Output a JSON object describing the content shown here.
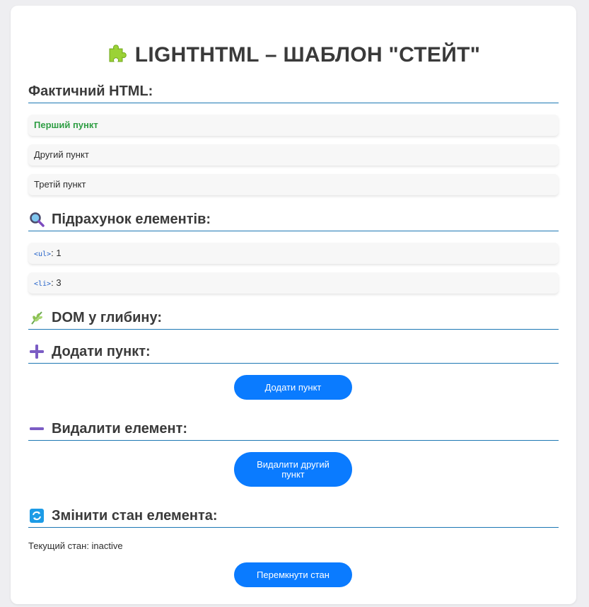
{
  "page": {
    "title_emoji": "🧩",
    "title": "LIGHTHTML – ШАБЛОН \"СТЕЙТ\""
  },
  "sections": {
    "actual_html": {
      "heading": "Фактичний HTML:"
    },
    "count": {
      "heading": "Підрахунок елементів:",
      "icon": "magnifier-icon"
    },
    "dom": {
      "heading": "DOM у глибину:",
      "icon": "herb-icon"
    },
    "add": {
      "heading": "Додати пункт:",
      "icon": "plus-icon"
    },
    "remove": {
      "heading": "Видалити елемент:",
      "icon": "minus-icon"
    },
    "toggle": {
      "heading": "Змінити стан елемента:",
      "icon": "refresh-icon"
    }
  },
  "list_items": [
    "Перший пункт",
    "Другий пункт",
    "Третій пункт"
  ],
  "counts": [
    {
      "tag": "<ul>",
      "value": ": 1"
    },
    {
      "tag": "<li>",
      "value": ": 3"
    }
  ],
  "buttons": {
    "add": "Додати пункт",
    "remove": "Видалити другий пункт",
    "toggle": "Перемкнути стан"
  },
  "state": {
    "label": "Текущий стан: inactive"
  },
  "colors": {
    "accent": "#0a7bff",
    "heading_rule": "#1d78b4",
    "first_item": "#2f9e44",
    "code": "#2563c9",
    "plus_minus": "#7b5cc4"
  }
}
